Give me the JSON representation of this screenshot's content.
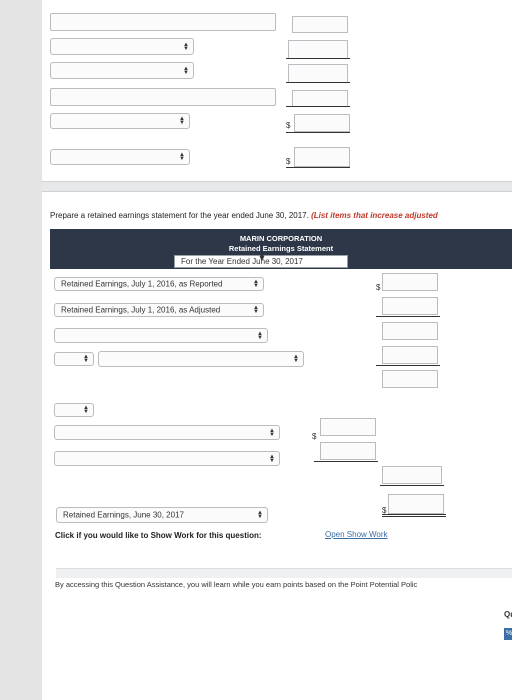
{
  "prompt": {
    "text": "Prepare a retained earnings statement for the year ended June 30, 2017.",
    "hint": "(List items that increase adjusted"
  },
  "statement": {
    "company": "MARIN CORPORATION",
    "title": "Retained Earnings Statement",
    "period": "For the Year Ended June 30, 2017"
  },
  "rows": {
    "beginning_reported": "Retained Earnings, July 1, 2016, as Reported",
    "beginning_adjusted": "Retained Earnings, July 1, 2016, as Adjusted",
    "ending": "Retained Earnings, June 30, 2017"
  },
  "currency_symbol": "$",
  "show_work": {
    "label": "Click if you would like to Show Work for this question:",
    "link": "Open Show Work"
  },
  "assistance": {
    "text": "By accessing this Question Assistance, you will learn while you earn points based on the Point Potential Polic"
  },
  "side": {
    "qu": "Qu",
    "pct": "%"
  }
}
